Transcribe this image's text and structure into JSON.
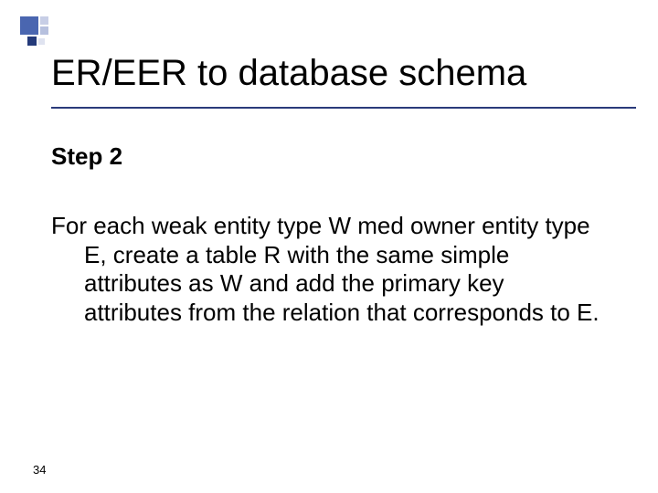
{
  "deco": {},
  "title": "ER/EER to database schema",
  "step_label": "Step 2",
  "body_text": "For each weak entity type W med owner entity type E, create a table R with the same simple attributes as W and add the primary key attributes from the relation that corresponds to E.",
  "page_number": "34"
}
